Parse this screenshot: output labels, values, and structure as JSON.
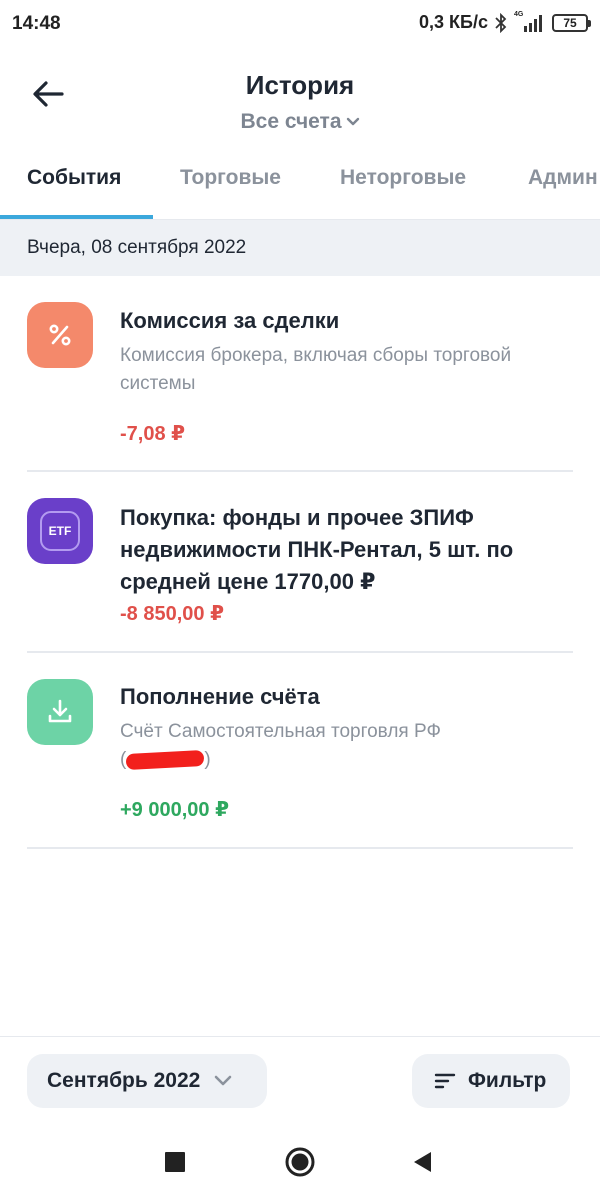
{
  "status_bar": {
    "time": "14:48",
    "speed": "0,3 КБ/с",
    "network": "4G",
    "battery": "75"
  },
  "header": {
    "title": "История",
    "account": "Все счета"
  },
  "tabs": [
    {
      "label": "События",
      "active": true
    },
    {
      "label": "Торговые",
      "active": false
    },
    {
      "label": "Неторговые",
      "active": false
    },
    {
      "label": "Админ",
      "active": false
    }
  ],
  "date_group": "Вчера, 08 сентября 2022",
  "events": [
    {
      "icon": "percent-icon",
      "icon_color": "#f4896b",
      "title": "Комиссия за сделки",
      "description": "Комиссия брокера, включая сборы торговой системы",
      "amount": "-7,08 ₽",
      "amount_type": "negative"
    },
    {
      "icon": "etf-icon",
      "icon_text": "ETF",
      "icon_color": "#6a3fc9",
      "title": "Покупка: фонды и прочее ЗПИФ недвижимости ПНК-Рентал, 5 шт. по средней цене 1770,00 ₽",
      "amount": "-8 850,00 ₽",
      "amount_type": "negative"
    },
    {
      "icon": "download-icon",
      "icon_color": "#6dd3a6",
      "title": "Пополнение счёта",
      "description": "Счёт Самостоятельная торговля РФ",
      "description_line2_open": "(",
      "description_line2_close": ")",
      "amount": "+9 000,00 ₽",
      "amount_type": "positive"
    }
  ],
  "bottom_bar": {
    "month": "Сентябрь 2022",
    "filter": "Фильтр"
  },
  "colors": {
    "accent": "#3ba8dc",
    "negative": "#e0504a",
    "positive": "#2ea85f"
  }
}
